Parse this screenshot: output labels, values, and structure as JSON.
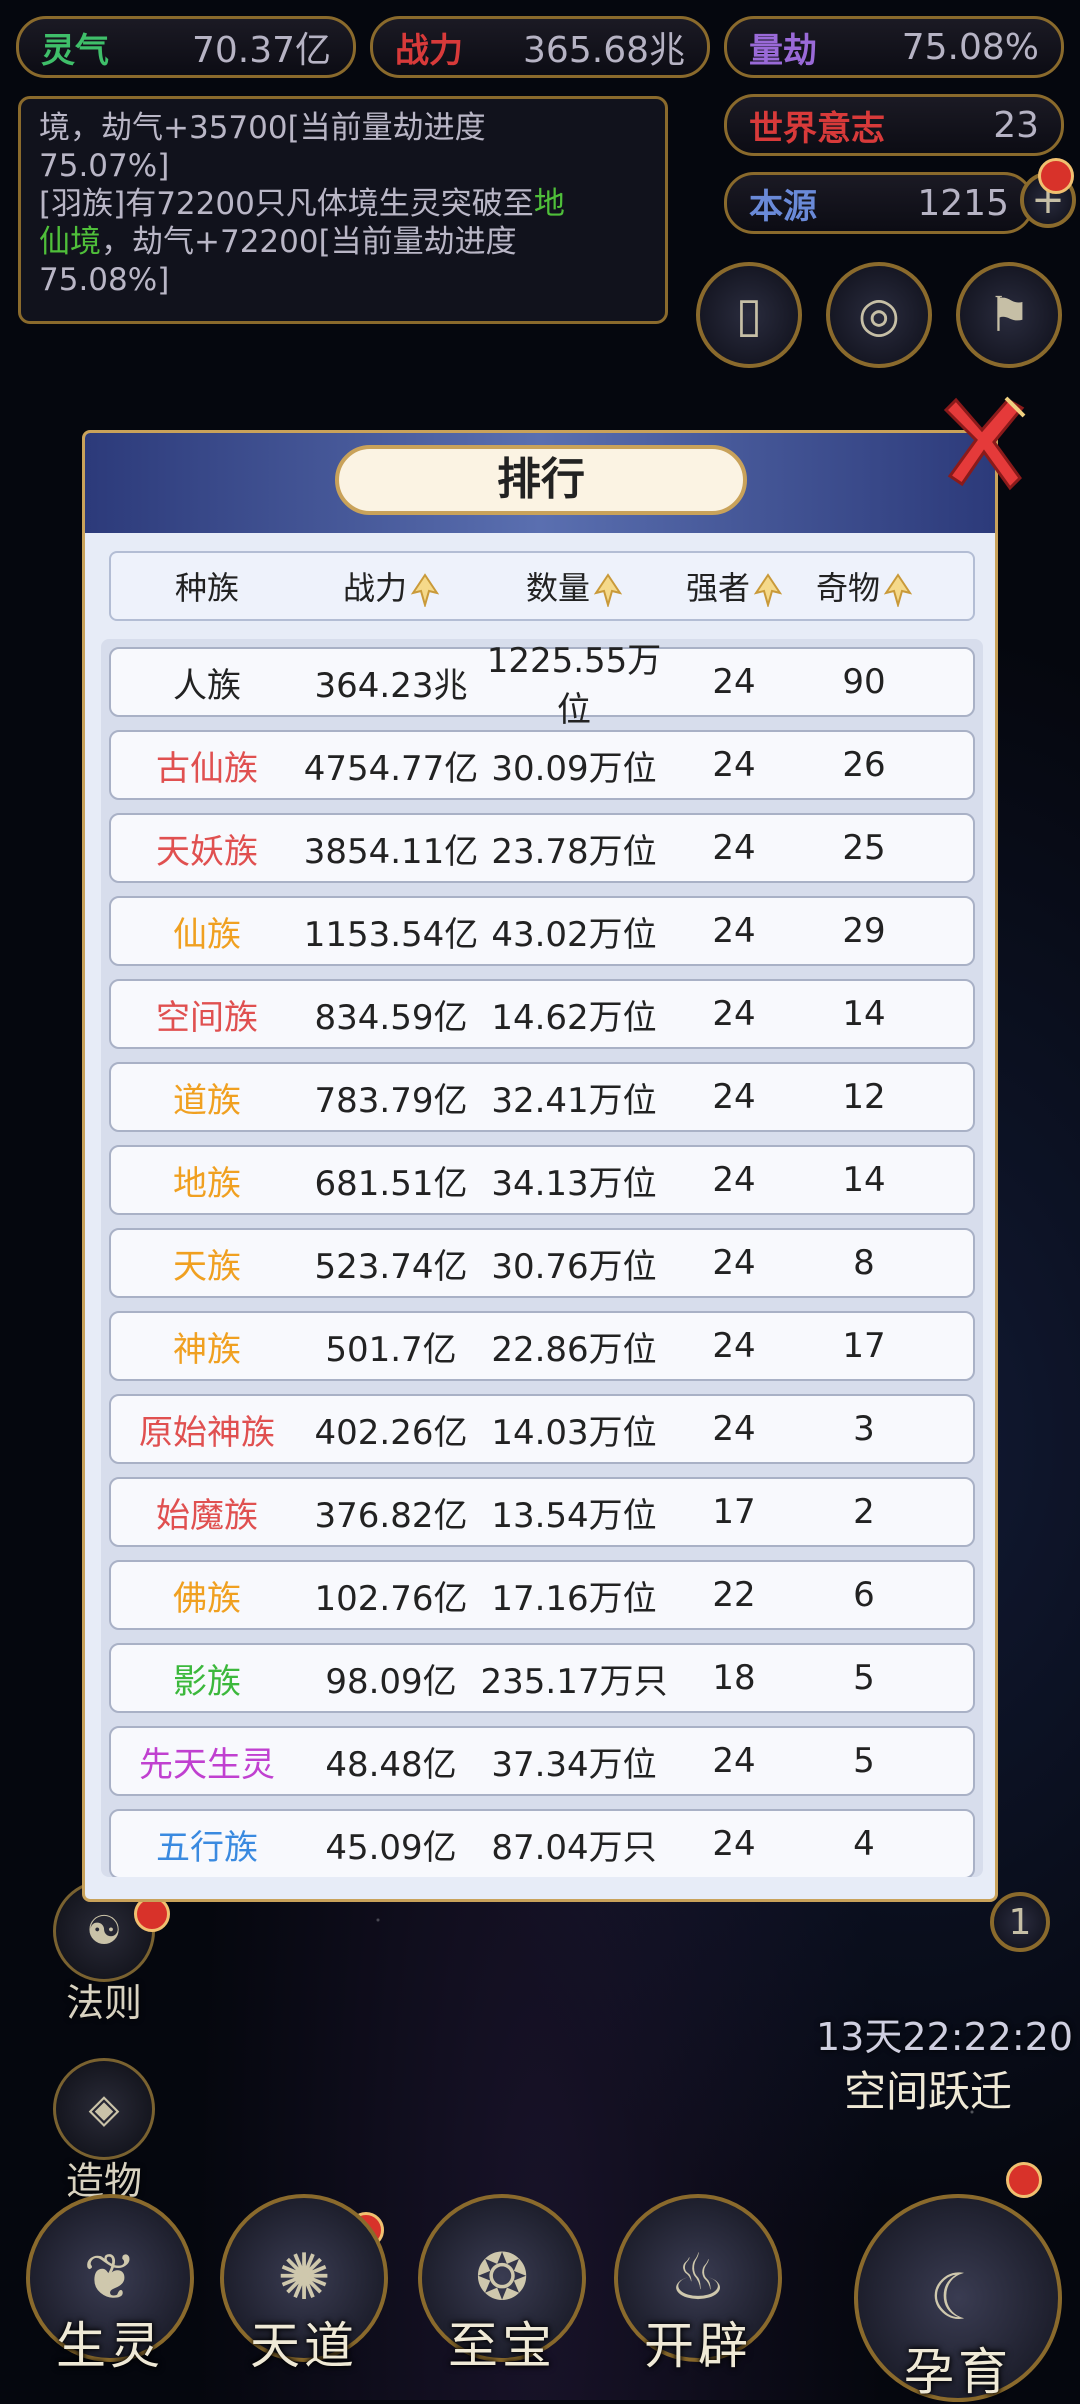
{
  "stats": {
    "lingqi": {
      "label": "灵气",
      "value": "70.37亿",
      "color": "#3fbf6a"
    },
    "zhanli": {
      "label": "战力",
      "value": "365.68兆",
      "color": "#d83a3a"
    },
    "lianjie": {
      "label": "量劫",
      "value": "75.08%",
      "color": "#9a6ad8"
    },
    "shijie": {
      "label": "世界意志",
      "value": "23",
      "color": "#d83a3a"
    },
    "benyuan": {
      "label": "本源",
      "value": "1215",
      "color": "#6a8ad8"
    }
  },
  "log": {
    "line1_a": "境，劫气+35700[当前量劫进度",
    "line1_b": "75.07%]",
    "line2_a": "[羽族]有72200只凡体境生灵突破至",
    "line2_g": "地",
    "line2_b": "仙境",
    "line2_c": "，劫气+72200[当前量劫进度",
    "line2_d": "75.08%]"
  },
  "modal": {
    "title": "排行",
    "headers": {
      "race": "种族",
      "power": "战力",
      "count": "数量",
      "strong": "强者",
      "treasure": "奇物"
    },
    "rows": [
      {
        "race": "人族",
        "power": "364.23兆",
        "count": "1225.55万位",
        "strong": "24",
        "treasure": "90",
        "color": "#222222"
      },
      {
        "race": "古仙族",
        "power": "4754.77亿",
        "count": "30.09万位",
        "strong": "24",
        "treasure": "26",
        "color": "#e05050"
      },
      {
        "race": "天妖族",
        "power": "3854.11亿",
        "count": "23.78万位",
        "strong": "24",
        "treasure": "25",
        "color": "#e05050"
      },
      {
        "race": "仙族",
        "power": "1153.54亿",
        "count": "43.02万位",
        "strong": "24",
        "treasure": "29",
        "color": "#f0a020"
      },
      {
        "race": "空间族",
        "power": "834.59亿",
        "count": "14.62万位",
        "strong": "24",
        "treasure": "14",
        "color": "#e05050"
      },
      {
        "race": "道族",
        "power": "783.79亿",
        "count": "32.41万位",
        "strong": "24",
        "treasure": "12",
        "color": "#f0a020"
      },
      {
        "race": "地族",
        "power": "681.51亿",
        "count": "34.13万位",
        "strong": "24",
        "treasure": "14",
        "color": "#f0a020"
      },
      {
        "race": "天族",
        "power": "523.74亿",
        "count": "30.76万位",
        "strong": "24",
        "treasure": "8",
        "color": "#f0a020"
      },
      {
        "race": "神族",
        "power": "501.7亿",
        "count": "22.86万位",
        "strong": "24",
        "treasure": "17",
        "color": "#f0a020"
      },
      {
        "race": "原始神族",
        "power": "402.26亿",
        "count": "14.03万位",
        "strong": "24",
        "treasure": "3",
        "color": "#e05050"
      },
      {
        "race": "始魔族",
        "power": "376.82亿",
        "count": "13.54万位",
        "strong": "17",
        "treasure": "2",
        "color": "#e05050"
      },
      {
        "race": "佛族",
        "power": "102.76亿",
        "count": "17.16万位",
        "strong": "22",
        "treasure": "6",
        "color": "#f0a020"
      },
      {
        "race": "影族",
        "power": "98.09亿",
        "count": "235.17万只",
        "strong": "18",
        "treasure": "5",
        "color": "#3cb83c"
      },
      {
        "race": "先天生灵",
        "power": "48.48亿",
        "count": "37.34万位",
        "strong": "24",
        "treasure": "5",
        "color": "#c040d0"
      },
      {
        "race": "五行族",
        "power": "45.09亿",
        "count": "87.04万只",
        "strong": "24",
        "treasure": "4",
        "color": "#3a8ae0"
      }
    ]
  },
  "side": {
    "fa": "法则",
    "zao": "造物"
  },
  "right_badge": "1",
  "timer": "13天22:22:20",
  "space_jump": "空间跃迁",
  "bottom": {
    "sheng": "生灵",
    "tian": "天道",
    "zhi": "至宝",
    "kai": "开辟",
    "yun": "孕育"
  }
}
